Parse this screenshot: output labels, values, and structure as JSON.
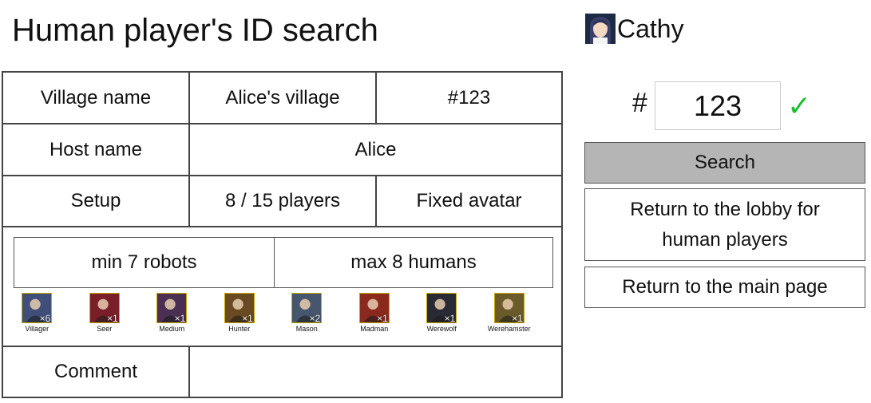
{
  "page": {
    "title": "Human player's ID search"
  },
  "user": {
    "name": "Cathy",
    "avatar_icon": "user-avatar-icon"
  },
  "village": {
    "name_label": "Village name",
    "name_value": "Alice's village",
    "id_value": "#123",
    "host_label": "Host name",
    "host_value": "Alice",
    "setup_label": "Setup",
    "players_value": "8 / 15 players",
    "avatar_mode": "Fixed avatar",
    "min_robots": "min 7 robots",
    "max_humans": "max 8 humans",
    "comment_label": "Comment",
    "comment_value": ""
  },
  "roles": [
    {
      "name": "Villager",
      "count": "×6",
      "icon": "villager-icon",
      "color": "#3f4f7a"
    },
    {
      "name": "Seer",
      "count": "×1",
      "icon": "seer-icon",
      "color": "#7a1f2a"
    },
    {
      "name": "Medium",
      "count": "×1",
      "icon": "medium-icon",
      "color": "#4b2f52"
    },
    {
      "name": "Hunter",
      "count": "×1",
      "icon": "hunter-icon",
      "color": "#6a4a22"
    },
    {
      "name": "Mason",
      "count": "×2",
      "icon": "mason-icon",
      "color": "#46566e"
    },
    {
      "name": "Madman",
      "count": "×1",
      "icon": "madman-icon",
      "color": "#8a2a1e"
    },
    {
      "name": "Werewolf",
      "count": "×1",
      "icon": "werewolf-icon",
      "color": "#2a2a36"
    },
    {
      "name": "Werehamster",
      "count": "×1",
      "icon": "werehamster-icon",
      "color": "#6b5a2a"
    }
  ],
  "search": {
    "hash": "#",
    "id_value": "123",
    "check_icon": "checkmark-icon",
    "check_color": "#1fbf32",
    "search_label": "Search",
    "lobby_label": "Return to the lobby for human players",
    "main_label": "Return to the main page"
  }
}
